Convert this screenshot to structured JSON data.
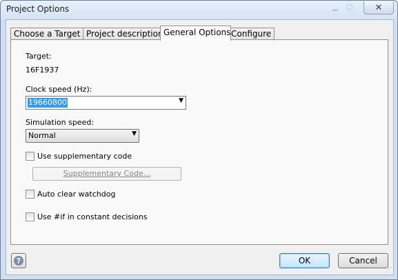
{
  "window": {
    "title": "Project Options",
    "close_icon": "✕"
  },
  "tabs": [
    {
      "label": "Choose a Target"
    },
    {
      "label": "Project description"
    },
    {
      "label": "General Options"
    },
    {
      "label": "Configure"
    }
  ],
  "active_tab": "General Options",
  "general": {
    "target_label": "Target:",
    "target_value": "16F1937",
    "clock_label": "Clock speed (Hz):",
    "clock_value": "19660800",
    "sim_label": "Simulation speed:",
    "sim_value": "Normal",
    "use_supp_label": "Use supplementary code",
    "use_supp_checked": false,
    "supp_button_label": "Supplementary Code...",
    "auto_clear_label": "Auto clear watchdog",
    "auto_clear_checked": false,
    "use_if_label": "Use #if in constant decisions",
    "use_if_checked": false
  },
  "footer": {
    "help_icon": "?",
    "ok_label": "OK",
    "cancel_label": "Cancel"
  }
}
